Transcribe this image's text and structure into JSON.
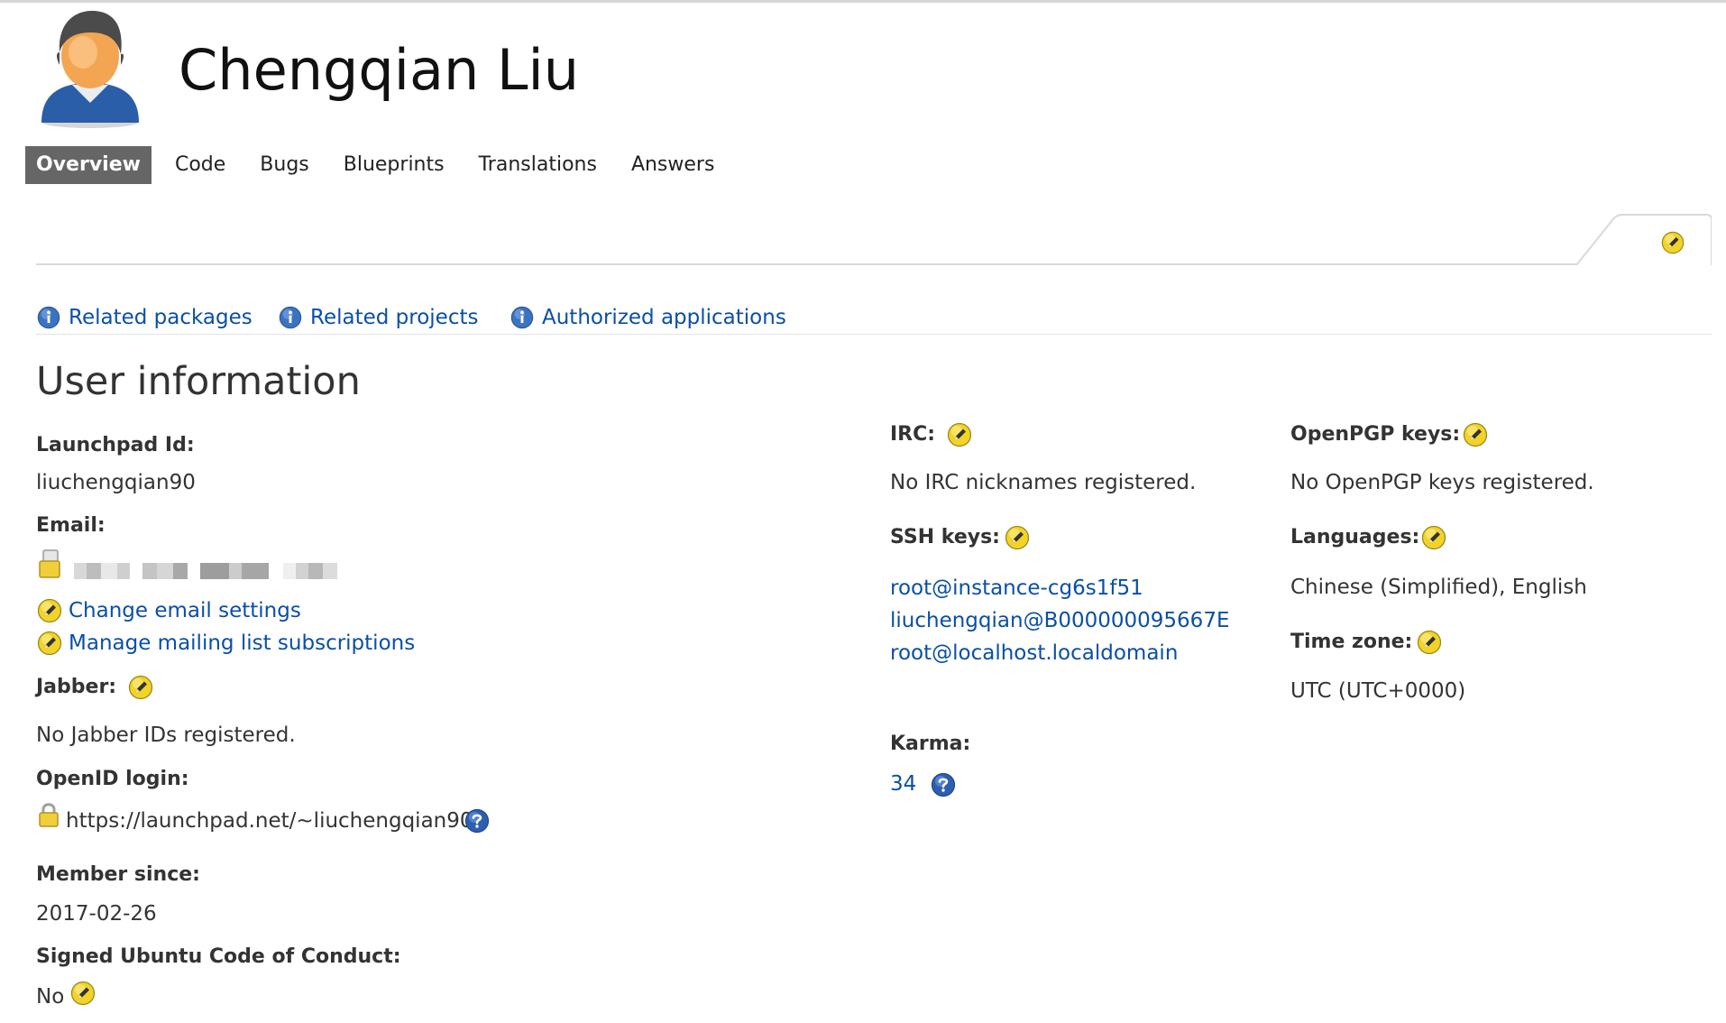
{
  "profile": {
    "name": "Chengqian Liu"
  },
  "tabs": [
    {
      "label": "Overview",
      "active": true
    },
    {
      "label": "Code",
      "active": false
    },
    {
      "label": "Bugs",
      "active": false
    },
    {
      "label": "Blueprints",
      "active": false
    },
    {
      "label": "Translations",
      "active": false
    },
    {
      "label": "Answers",
      "active": false
    }
  ],
  "related_links": {
    "packages": "Related packages",
    "projects": "Related projects",
    "applications": "Authorized applications"
  },
  "section_title": "User information",
  "left": {
    "launchpad_id_label": "Launchpad Id:",
    "launchpad_id": "liuchengqian90",
    "email_label": "Email:",
    "change_email": "Change email settings",
    "manage_mailing": "Manage mailing list subscriptions",
    "jabber_label": "Jabber:",
    "jabber_value": "No Jabber IDs registered.",
    "openid_label": "OpenID login:",
    "openid_value": "https://launchpad.net/~liuchengqian90",
    "member_since_label": "Member since:",
    "member_since": "2017-02-26",
    "coc_label": "Signed Ubuntu Code of Conduct:",
    "coc_value": "No"
  },
  "middle": {
    "irc_label": "IRC:",
    "irc_value": "No IRC nicknames registered.",
    "ssh_label": "SSH keys:",
    "ssh_keys": [
      "root@instance-cg6s1f51",
      "liuchengqian@B000000095667E",
      "root@localhost.localdomain"
    ],
    "karma_label": "Karma:",
    "karma_value": "34"
  },
  "right": {
    "pgp_label": "OpenPGP keys:",
    "pgp_value": "No OpenPGP keys registered.",
    "languages_label": "Languages:",
    "languages_value": "Chinese (Simplified), English",
    "timezone_label": "Time zone:",
    "timezone_value": "UTC (UTC+0000)"
  },
  "colors": {
    "link": "#0a4fa7",
    "active_tab_bg": "#666666",
    "edit_icon": "#f2d327",
    "info_icon": "#3b73c2"
  },
  "icons": {
    "edit": "pencil-edit-icon",
    "info": "info-icon",
    "help": "help-question-icon",
    "lock": "lock-icon",
    "email": "email-icon",
    "avatar": "user-avatar"
  }
}
